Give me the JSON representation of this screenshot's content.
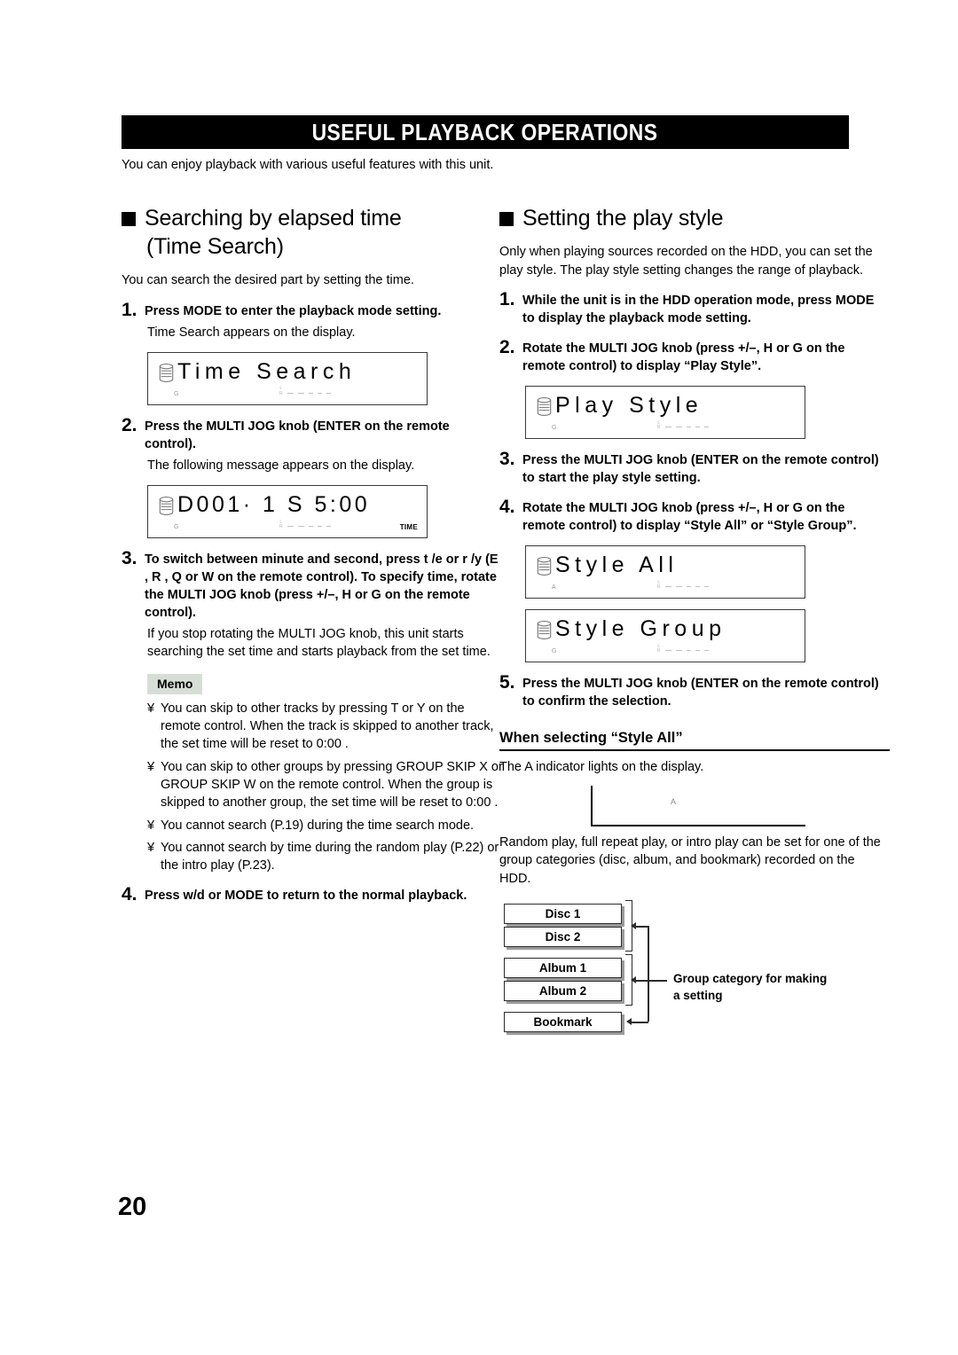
{
  "header": {
    "title": "USEFUL PLAYBACK OPERATIONS",
    "intro": "You can enjoy playback with various useful features with this unit."
  },
  "page_number": "20",
  "left_column": {
    "heading_line1": "Searching by elapsed time",
    "heading_line2": "(Time Search)",
    "lead": "You can search the desired part by setting the time.",
    "steps": [
      {
        "num": "1.",
        "text": "Press MODE to enter the playback mode setting.",
        "sub": "Time Search  appears on the display."
      },
      {
        "num": "2.",
        "text": "Press the MULTI JOG knob (ENTER on the remote control).",
        "sub": "The following message appears on the display."
      },
      {
        "num": "3.",
        "text": "To switch between minute and second, press t  /e or r  /y  (E  , R  , Q or W on the remote control). To specify time, rotate the MULTI JOG knob (press +/–, H or G on the remote control).",
        "sub": "If you stop rotating the MULTI JOG knob, this unit starts searching the set time and starts playback from the set time."
      },
      {
        "num": "4.",
        "text": "Press w/d  or MODE to return to the normal playback.",
        "sub": ""
      }
    ],
    "lcd_time_search": {
      "text": "Time  Search",
      "mini_mark": "G",
      "time_label": ""
    },
    "lcd_d001": {
      "text": "D001·  1  S    5:00",
      "mini_mark": "G",
      "time_label": "TIME"
    },
    "memo": {
      "badge": "Memo",
      "bullet": "¥",
      "items": [
        "You can skip to other tracks by pressing T or Y   on the remote control. When the track is skipped to another track, the set time will be reset to  0:00 .",
        "You can skip to other groups by pressing GROUP SKIP X or GROUP SKIP W on the remote control. When the group is skipped to another group, the set time will be reset to  0:00 .",
        "You cannot search (P.19) during the time search mode.",
        "You cannot search by time during the random play (P.22) or the intro play (P.23)."
      ]
    }
  },
  "right_column": {
    "heading": "Setting the play style",
    "lead": "Only when playing sources recorded on the HDD, you can set the play style. The play style setting changes the range of playback.",
    "steps": [
      {
        "num": "1.",
        "text": "While the unit is in the HDD operation mode, press MODE to display the playback mode setting."
      },
      {
        "num": "2.",
        "text": "Rotate the MULTI JOG knob (press +/–, H or G on the remote control) to display “Play Style”."
      },
      {
        "num": "3.",
        "text": "Press the MULTI JOG knob (ENTER on the remote control) to start the play style setting."
      },
      {
        "num": "4.",
        "text": "Rotate the MULTI JOG knob (press +/–, H or G on the remote control) to display “Style All” or “Style Group”."
      },
      {
        "num": "5.",
        "text": "Press the MULTI JOG knob (ENTER on the remote control) to confirm the selection."
      }
    ],
    "lcd_play_style": {
      "text": "Play  Style",
      "mini_mark": "G"
    },
    "lcd_style_all": {
      "text": "Style  All",
      "mini_mark": "A"
    },
    "lcd_style_group": {
      "text": "Style  Group",
      "mini_mark": "G"
    },
    "subheading": "When selecting “Style All”",
    "indicator_para": "The A indicator lights on the display.",
    "indicator_mark": "A",
    "closing_para": "Random play, full repeat play, or intro play can be set for one of the group categories (disc, album, and bookmark) recorded on the HDD.",
    "diagram": {
      "boxes": [
        "Disc 1",
        "Disc 2",
        "Album 1",
        "Album 2",
        "Bookmark"
      ],
      "label": "Group category for making a setting"
    }
  }
}
